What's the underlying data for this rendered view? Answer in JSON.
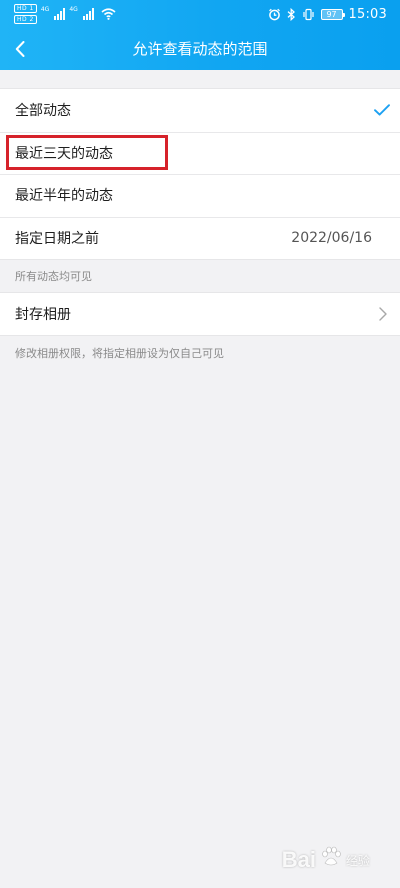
{
  "status_bar": {
    "hd_badges": [
      "HD 1",
      "HD 2"
    ],
    "signal_tags": [
      "4G",
      "4G"
    ],
    "battery": "97",
    "time": "15:03"
  },
  "nav": {
    "title": "允许查看动态的范围",
    "back_icon": "chevron-left-icon"
  },
  "options": [
    {
      "label": "全部动态",
      "selected": true
    },
    {
      "label": "最近三天的动态",
      "selected": false
    },
    {
      "label": "最近半年的动态",
      "selected": false
    },
    {
      "label": "指定日期之前",
      "selected": false,
      "value": "2022/06/16"
    }
  ],
  "options_hint": "所有动态均可见",
  "album": {
    "label": "封存相册",
    "hint": "修改相册权限，将指定相册设为仅自己可见"
  },
  "watermark": {
    "text": "Bai",
    "sub": "经验"
  },
  "colors": {
    "header": "#13a8f3",
    "check": "#1da1f2",
    "highlight": "#d6222a"
  }
}
